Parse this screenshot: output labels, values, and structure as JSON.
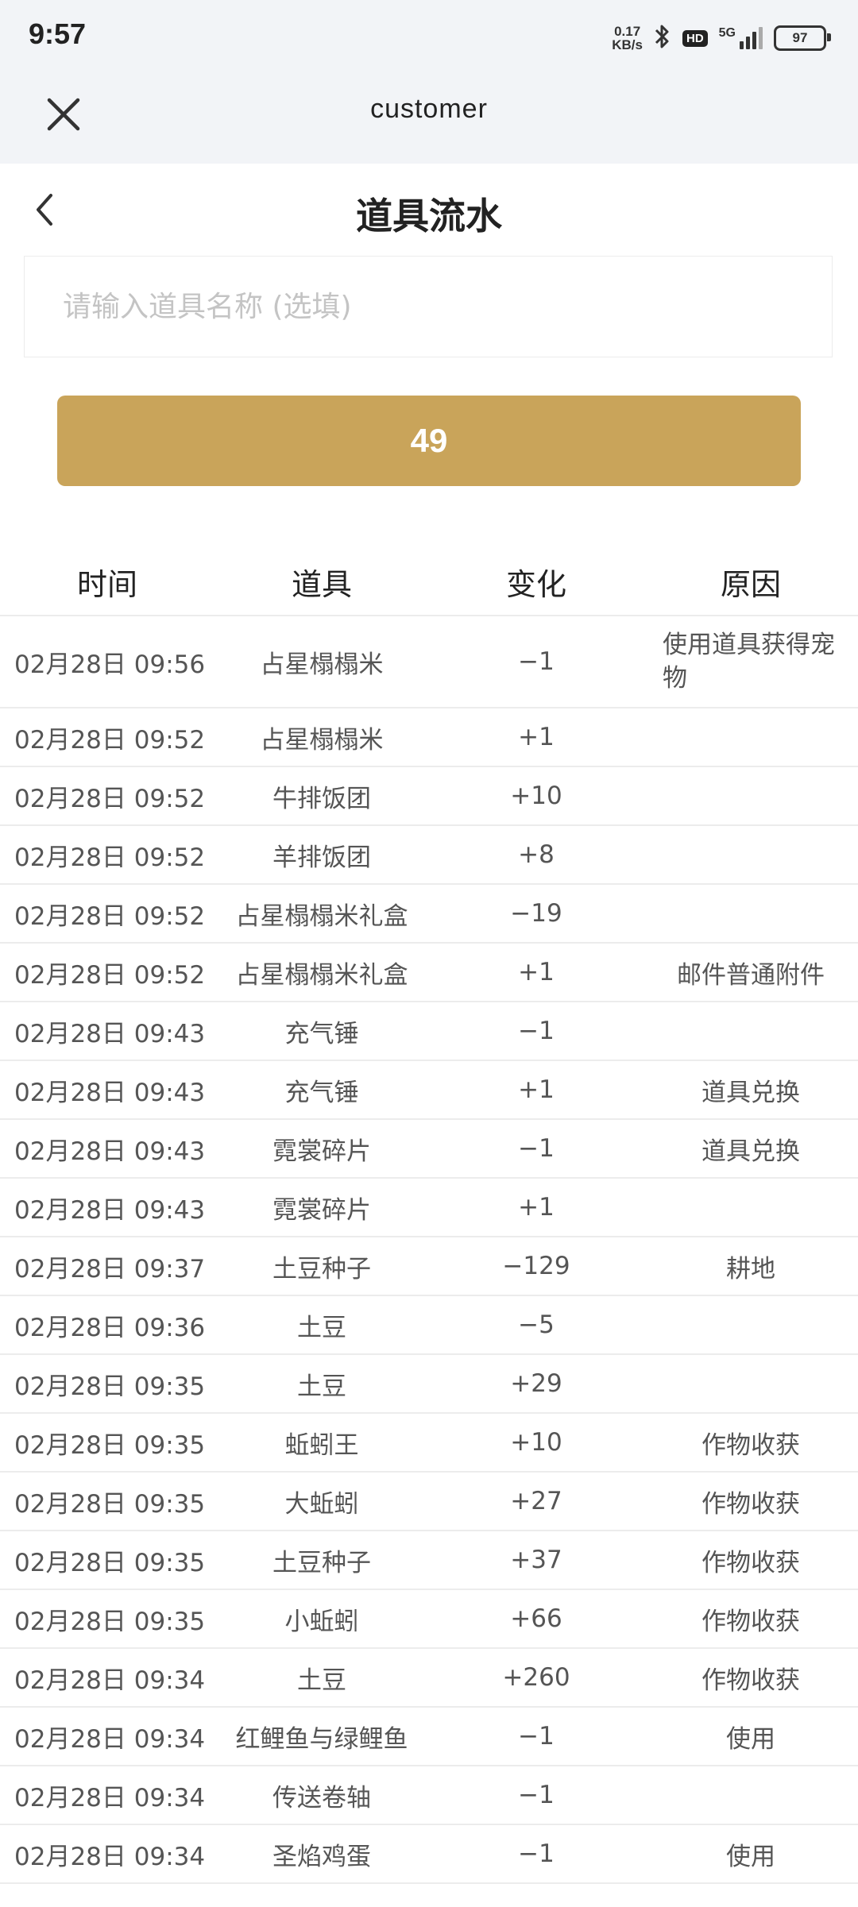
{
  "status_bar": {
    "time": "9:57",
    "net_speed_value": "0.17",
    "net_speed_unit": "KB/s",
    "hd_label": "HD",
    "network_label": "5G",
    "battery_level": "97"
  },
  "app_bar": {
    "title": "customer"
  },
  "page": {
    "title": "道具流水"
  },
  "search": {
    "placeholder": "请输入道具名称 (选填)",
    "value": ""
  },
  "query_button": {
    "label": "49"
  },
  "table": {
    "headers": [
      "时间",
      "道具",
      "变化",
      "原因"
    ],
    "rows": [
      {
        "time": "02月28日 09:56",
        "item": "占星榻榻米",
        "change": "−1",
        "reason": "使用道具获得宠物"
      },
      {
        "time": "02月28日 09:52",
        "item": "占星榻榻米",
        "change": "+1",
        "reason": ""
      },
      {
        "time": "02月28日 09:52",
        "item": "牛排饭团",
        "change": "+10",
        "reason": ""
      },
      {
        "time": "02月28日 09:52",
        "item": "羊排饭团",
        "change": "+8",
        "reason": ""
      },
      {
        "time": "02月28日 09:52",
        "item": "占星榻榻米礼盒",
        "change": "−19",
        "reason": ""
      },
      {
        "time": "02月28日 09:52",
        "item": "占星榻榻米礼盒",
        "change": "+1",
        "reason": "邮件普通附件"
      },
      {
        "time": "02月28日 09:43",
        "item": "充气锤",
        "change": "−1",
        "reason": ""
      },
      {
        "time": "02月28日 09:43",
        "item": "充气锤",
        "change": "+1",
        "reason": "道具兑换"
      },
      {
        "time": "02月28日 09:43",
        "item": "霓裳碎片",
        "change": "−1",
        "reason": "道具兑换"
      },
      {
        "time": "02月28日 09:43",
        "item": "霓裳碎片",
        "change": "+1",
        "reason": ""
      },
      {
        "time": "02月28日 09:37",
        "item": "土豆种子",
        "change": "−129",
        "reason": "耕地"
      },
      {
        "time": "02月28日 09:36",
        "item": "土豆",
        "change": "−5",
        "reason": ""
      },
      {
        "time": "02月28日 09:35",
        "item": "土豆",
        "change": "+29",
        "reason": ""
      },
      {
        "time": "02月28日 09:35",
        "item": "蚯蚓王",
        "change": "+10",
        "reason": "作物收获"
      },
      {
        "time": "02月28日 09:35",
        "item": "大蚯蚓",
        "change": "+27",
        "reason": "作物收获"
      },
      {
        "time": "02月28日 09:35",
        "item": "土豆种子",
        "change": "+37",
        "reason": "作物收获"
      },
      {
        "time": "02月28日 09:35",
        "item": "小蚯蚓",
        "change": "+66",
        "reason": "作物收获"
      },
      {
        "time": "02月28日 09:34",
        "item": "土豆",
        "change": "+260",
        "reason": "作物收获"
      },
      {
        "time": "02月28日 09:34",
        "item": "红鲤鱼与绿鲤鱼",
        "change": "−1",
        "reason": "使用"
      },
      {
        "time": "02月28日 09:34",
        "item": "传送卷轴",
        "change": "−1",
        "reason": ""
      },
      {
        "time": "02月28日 09:34",
        "item": "圣焰鸡蛋",
        "change": "−1",
        "reason": "使用"
      }
    ]
  },
  "colors": {
    "accent": "#c9a45a",
    "header_bg": "#f2f4f7",
    "divider": "#ececec"
  }
}
